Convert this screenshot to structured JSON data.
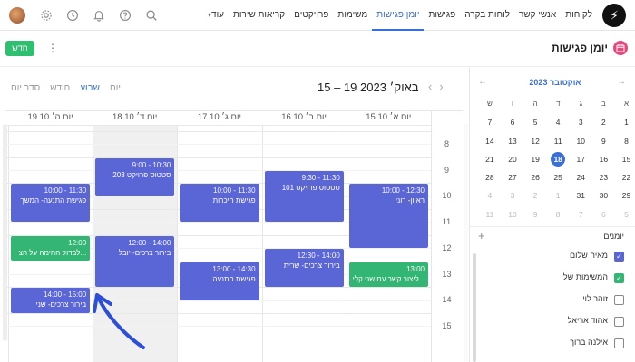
{
  "app": {
    "logo_glyph": "⚡"
  },
  "nav": {
    "items": [
      "לקוחות",
      "אנשי קשר",
      "לוחות בקרה",
      "פגישות",
      "יומן פגישות",
      "משימות",
      "פרויקטים",
      "קריאות שירות"
    ],
    "active_index": 4,
    "more_label": "עוד"
  },
  "page": {
    "title": "יומן פגישות",
    "new_label": "חדש"
  },
  "toolbar": {
    "views": [
      "סדר יום",
      "חודש",
      "שבוע",
      "יום"
    ],
    "active_view": "שבוע",
    "range": "15 – 19 באוק׳ 2023"
  },
  "days": [
    "יום א׳ 15.10",
    "יום ב׳ 16.10",
    "יום ג׳ 17.10",
    "יום ד׳ 18.10",
    "יום ה׳ 19.10"
  ],
  "today_index": 3,
  "hours": [
    "8",
    "9",
    "10",
    "11",
    "12",
    "13",
    "14",
    "15"
  ],
  "events": [
    {
      "day": 0,
      "start": "10:00",
      "end": "12:30",
      "time": "10:00 - 12:30",
      "title": "ראיון- רוני",
      "color": "blue"
    },
    {
      "day": 0,
      "start": "13:00",
      "end": "14:00",
      "time": "13:00",
      "title": "ליצור קשר עם שני קלי...",
      "color": "green"
    },
    {
      "day": 1,
      "start": "9:30",
      "end": "11:30",
      "time": "9:30 - 11:30",
      "title": "סטטוס פרויקט 101",
      "color": "blue"
    },
    {
      "day": 1,
      "start": "12:30",
      "end": "14:00",
      "time": "12:30 - 14:00",
      "title": "בירור צרכים- שרית",
      "color": "blue"
    },
    {
      "day": 2,
      "start": "10:00",
      "end": "11:30",
      "time": "10:00 - 11:30",
      "title": "פגישת היכרות",
      "color": "blue"
    },
    {
      "day": 2,
      "start": "13:00",
      "end": "14:30",
      "time": "13:00 - 14:30",
      "title": "פגישת התנעה",
      "color": "blue"
    },
    {
      "day": 3,
      "start": "9:00",
      "end": "10:30",
      "time": "9:00 - 10:30",
      "title": "סטטוס פרויקט 203",
      "color": "blue"
    },
    {
      "day": 3,
      "start": "12:00",
      "end": "14:00",
      "time": "12:00 - 14:00",
      "title": "בירור צרכים- יובל",
      "color": "blue"
    },
    {
      "day": 4,
      "start": "10:00",
      "end": "11:30",
      "time": "10:00 - 11:30",
      "title": "פגישת התנעה- המשך",
      "color": "blue"
    },
    {
      "day": 4,
      "start": "12:00",
      "end": "13:00",
      "time": "12:00",
      "title": "לבדוק החימה על הצ...",
      "color": "green"
    },
    {
      "day": 4,
      "start": "14:00",
      "end": "15:00",
      "time": "14:00 - 15:00",
      "title": "בירור צרכים- שני",
      "color": "blue"
    }
  ],
  "mini_calendar": {
    "month": "אוקטובר 2023",
    "weekdays": [
      "א",
      "ב",
      "ג",
      "ד",
      "ה",
      "ו",
      "ש"
    ],
    "weeks": [
      [
        {
          "d": "1"
        },
        {
          "d": "2"
        },
        {
          "d": "3"
        },
        {
          "d": "4"
        },
        {
          "d": "5"
        },
        {
          "d": "6"
        },
        {
          "d": "7"
        }
      ],
      [
        {
          "d": "8"
        },
        {
          "d": "9"
        },
        {
          "d": "10"
        },
        {
          "d": "11"
        },
        {
          "d": "12"
        },
        {
          "d": "13"
        },
        {
          "d": "14"
        }
      ],
      [
        {
          "d": "15"
        },
        {
          "d": "16"
        },
        {
          "d": "17"
        },
        {
          "d": "18",
          "today": true
        },
        {
          "d": "19"
        },
        {
          "d": "20"
        },
        {
          "d": "21"
        }
      ],
      [
        {
          "d": "22"
        },
        {
          "d": "23"
        },
        {
          "d": "24"
        },
        {
          "d": "25"
        },
        {
          "d": "26"
        },
        {
          "d": "27"
        },
        {
          "d": "28"
        }
      ],
      [
        {
          "d": "29"
        },
        {
          "d": "30"
        },
        {
          "d": "31"
        },
        {
          "d": "1",
          "muted": true
        },
        {
          "d": "2",
          "muted": true
        },
        {
          "d": "3",
          "muted": true
        },
        {
          "d": "4",
          "muted": true
        }
      ],
      [
        {
          "d": "5",
          "muted": true
        },
        {
          "d": "6",
          "muted": true
        },
        {
          "d": "7",
          "muted": true
        },
        {
          "d": "8",
          "muted": true
        },
        {
          "d": "9",
          "muted": true
        },
        {
          "d": "10",
          "muted": true
        },
        {
          "d": "11",
          "muted": true
        }
      ]
    ]
  },
  "calendars": {
    "title": "יומנים",
    "items": [
      {
        "label": "מאיה שלום",
        "checked": true,
        "color": "#5b66d6"
      },
      {
        "label": "המשימות שלי",
        "checked": true,
        "color": "#33b673"
      },
      {
        "label": "זוהר לוי",
        "checked": false
      },
      {
        "label": "אהוד אריאל",
        "checked": false
      },
      {
        "label": "אילנה ברוך",
        "checked": false
      }
    ]
  },
  "colors": {
    "accent": "#3b6fd8",
    "event_blue": "#5b66d6",
    "event_green": "#33b673",
    "new_button": "#2fbf71",
    "annotation_arrow": "#2d4fd6"
  }
}
